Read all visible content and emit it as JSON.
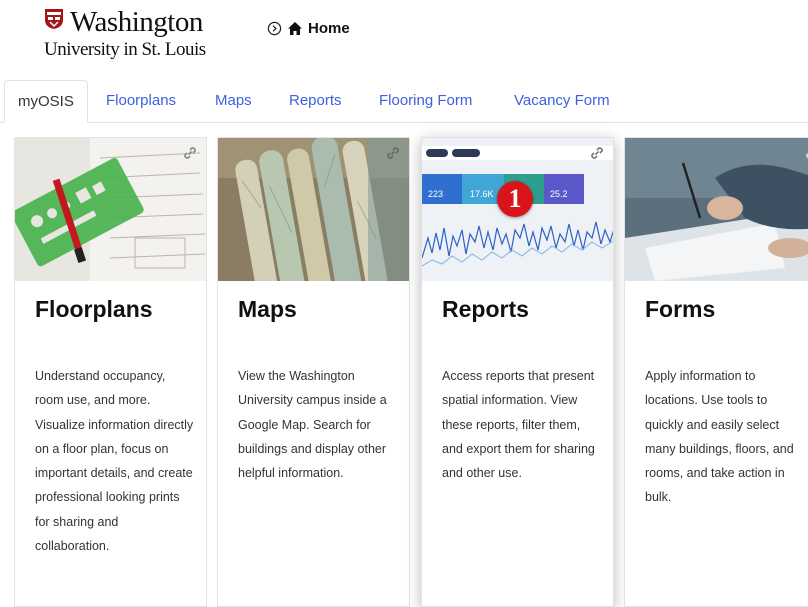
{
  "header": {
    "logo_line1": "Washington",
    "logo_line2": "University in St. Louis",
    "breadcrumb": "Home"
  },
  "tabs": [
    {
      "label": "myOSIS",
      "active": true
    },
    {
      "label": "Floorplans",
      "active": false
    },
    {
      "label": "Maps",
      "active": false
    },
    {
      "label": "Reports",
      "active": false
    },
    {
      "label": "Flooring Form",
      "active": false
    },
    {
      "label": "Vacancy Form",
      "active": false
    }
  ],
  "cards": [
    {
      "title": "Floorplans",
      "description": "Understand occupancy, room use, and more. Visualize information directly on a floor plan, focus on important details, and create professional looking prints for sharing and collaboration.",
      "image": "drafting-template-photo",
      "link_icon": "link-icon"
    },
    {
      "title": "Maps",
      "description": "View the Washington University campus inside a Google Map. Search for buildings and display other helpful information.",
      "image": "rolled-maps-photo",
      "link_icon": "link-icon"
    },
    {
      "title": "Reports",
      "description": "Access reports that present spatial information. View these reports, filter them, and export them for sharing and other use.",
      "image": "analytics-dashboard-photo",
      "link_icon": "link-icon",
      "dashboard_stats": [
        "223",
        "17.6K",
        "25.2"
      ]
    },
    {
      "title": "Forms",
      "description": "Apply information to locations. Use tools to quickly and easily select many buildings, floors, and rooms, and take action in bulk.",
      "image": "signing-document-photo",
      "link_icon": "link-icon"
    }
  ],
  "annotation_badge": "1",
  "colors": {
    "tab_link": "#3e60e0",
    "badge": "#d9141b",
    "brand": "#a51417"
  }
}
